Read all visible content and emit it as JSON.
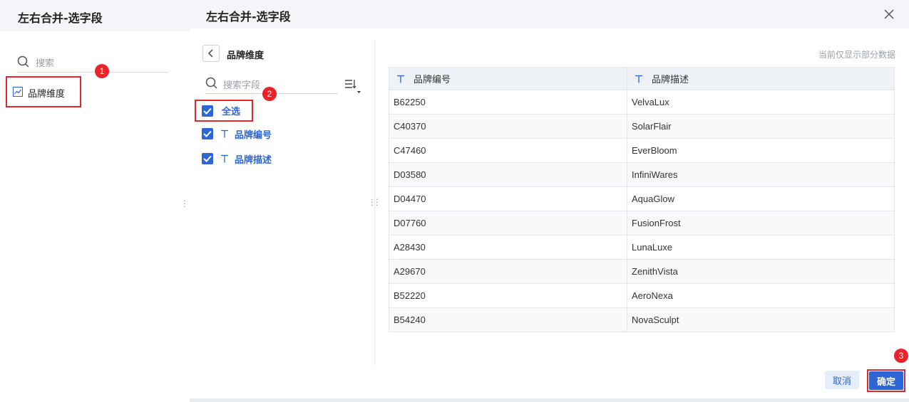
{
  "background": {
    "title": "左右合并-选字段",
    "search_placeholder": "搜索",
    "selected_item": "品牌维度",
    "badge1": "1"
  },
  "dialog": {
    "title": "左右合并-选字段",
    "field_panel": {
      "title": "品牌维度",
      "search_placeholder": "搜索字段",
      "badge2": "2",
      "select_all_label": "全选",
      "fields": [
        {
          "label": "品牌编号",
          "checked": true,
          "type": "text"
        },
        {
          "label": "品牌描述",
          "checked": true,
          "type": "text"
        }
      ]
    },
    "preview": {
      "note": "当前仅显示部分数据",
      "columns": [
        "品牌编号",
        "品牌描述"
      ],
      "rows": [
        [
          "B62250",
          "VelvaLux"
        ],
        [
          "C40370",
          "SolarFlair"
        ],
        [
          "C47460",
          "EverBloom"
        ],
        [
          "D03580",
          "InfiniWares"
        ],
        [
          "D04470",
          "AquaGlow"
        ],
        [
          "D07760",
          "FusionFrost"
        ],
        [
          "A28430",
          "LunaLuxe"
        ],
        [
          "A29670",
          "ZenithVista"
        ],
        [
          "B52220",
          "AeroNexa"
        ],
        [
          "B54240",
          "NovaSculpt"
        ]
      ]
    },
    "footer": {
      "cancel_label": "取消",
      "ok_label": "确定",
      "badge3": "3"
    }
  },
  "colors": {
    "accent": "#2d66d4",
    "highlight": "#e0282e",
    "badge": "#e8232a"
  }
}
